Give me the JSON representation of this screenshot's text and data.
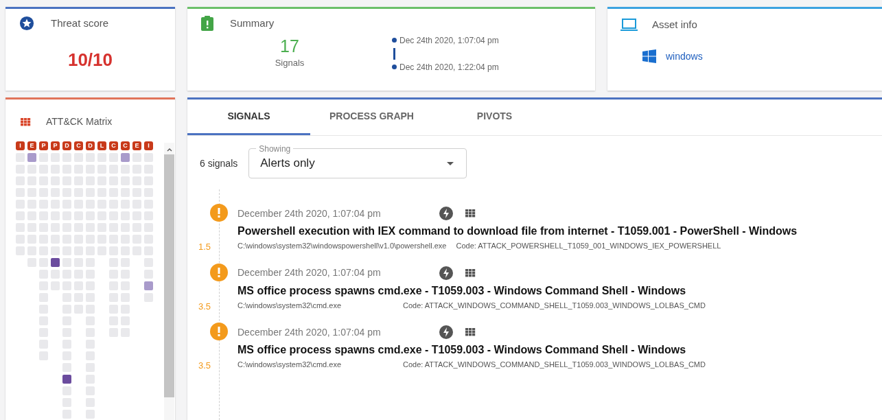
{
  "threat_score": {
    "title": "Threat score",
    "value": "10/10"
  },
  "summary": {
    "title": "Summary",
    "count": "17",
    "count_label": "Signals",
    "start": "Dec 24th 2020, 1:07:04 pm",
    "end": "Dec 24th 2020, 1:22:04 pm"
  },
  "asset_info": {
    "title": "Asset info",
    "os": "windows"
  },
  "matrix": {
    "title": "ATT&CK Matrix",
    "columns": [
      {
        "letter": "I",
        "cells": [
          {
            "kind": "empty"
          },
          {
            "kind": "empty"
          },
          {
            "kind": "empty"
          },
          {
            "kind": "empty"
          },
          {
            "kind": "empty"
          },
          {
            "kind": "empty"
          },
          {
            "kind": "empty"
          },
          {
            "kind": "empty"
          },
          {
            "kind": "empty"
          }
        ]
      },
      {
        "letter": "E",
        "cells": [
          {
            "kind": "low"
          },
          {
            "kind": "empty"
          },
          {
            "kind": "empty"
          },
          {
            "kind": "empty"
          },
          {
            "kind": "empty"
          },
          {
            "kind": "empty"
          },
          {
            "kind": "empty"
          },
          {
            "kind": "empty"
          },
          {
            "kind": "empty"
          },
          {
            "kind": "empty"
          }
        ]
      },
      {
        "letter": "P",
        "cells": [
          {
            "kind": "empty"
          },
          {
            "kind": "empty"
          },
          {
            "kind": "empty"
          },
          {
            "kind": "empty"
          },
          {
            "kind": "empty"
          },
          {
            "kind": "empty"
          },
          {
            "kind": "empty"
          },
          {
            "kind": "empty"
          },
          {
            "kind": "empty"
          },
          {
            "kind": "empty"
          },
          {
            "kind": "empty"
          },
          {
            "kind": "empty"
          },
          {
            "kind": "empty"
          },
          {
            "kind": "empty"
          },
          {
            "kind": "empty"
          },
          {
            "kind": "empty"
          },
          {
            "kind": "empty"
          },
          {
            "kind": "empty"
          }
        ]
      },
      {
        "letter": "P",
        "cells": [
          {
            "kind": "empty"
          },
          {
            "kind": "empty"
          },
          {
            "kind": "empty"
          },
          {
            "kind": "empty"
          },
          {
            "kind": "empty"
          },
          {
            "kind": "empty"
          },
          {
            "kind": "empty"
          },
          {
            "kind": "empty"
          },
          {
            "kind": "empty"
          },
          {
            "kind": "high"
          },
          {
            "kind": "empty"
          },
          {
            "kind": "empty"
          }
        ]
      },
      {
        "letter": "D",
        "cells": [
          {
            "kind": "empty"
          },
          {
            "kind": "empty"
          },
          {
            "kind": "empty"
          },
          {
            "kind": "empty"
          },
          {
            "kind": "empty"
          },
          {
            "kind": "empty"
          },
          {
            "kind": "empty"
          },
          {
            "kind": "empty"
          },
          {
            "kind": "empty"
          },
          {
            "kind": "empty"
          },
          {
            "kind": "empty"
          },
          {
            "kind": "empty"
          },
          {
            "kind": "empty"
          },
          {
            "kind": "empty"
          },
          {
            "kind": "empty"
          },
          {
            "kind": "empty"
          },
          {
            "kind": "empty"
          },
          {
            "kind": "empty"
          },
          {
            "kind": "empty"
          },
          {
            "kind": "high"
          },
          {
            "kind": "empty"
          },
          {
            "kind": "empty"
          },
          {
            "kind": "empty"
          }
        ]
      },
      {
        "letter": "C",
        "cells": [
          {
            "kind": "empty"
          },
          {
            "kind": "empty"
          },
          {
            "kind": "empty"
          },
          {
            "kind": "empty"
          },
          {
            "kind": "empty"
          },
          {
            "kind": "empty"
          },
          {
            "kind": "empty"
          },
          {
            "kind": "empty"
          },
          {
            "kind": "empty"
          },
          {
            "kind": "empty"
          },
          {
            "kind": "empty"
          },
          {
            "kind": "empty"
          },
          {
            "kind": "empty"
          },
          {
            "kind": "empty"
          }
        ]
      },
      {
        "letter": "D",
        "cells": [
          {
            "kind": "empty"
          },
          {
            "kind": "empty"
          },
          {
            "kind": "empty"
          },
          {
            "kind": "empty"
          },
          {
            "kind": "empty"
          },
          {
            "kind": "empty"
          },
          {
            "kind": "empty"
          },
          {
            "kind": "empty"
          },
          {
            "kind": "empty"
          },
          {
            "kind": "empty"
          },
          {
            "kind": "empty"
          },
          {
            "kind": "empty"
          },
          {
            "kind": "empty"
          },
          {
            "kind": "empty"
          },
          {
            "kind": "empty"
          },
          {
            "kind": "empty"
          },
          {
            "kind": "empty"
          },
          {
            "kind": "empty"
          },
          {
            "kind": "empty"
          },
          {
            "kind": "empty"
          },
          {
            "kind": "empty"
          },
          {
            "kind": "empty"
          },
          {
            "kind": "empty"
          }
        ]
      },
      {
        "letter": "L",
        "cells": [
          {
            "kind": "empty"
          },
          {
            "kind": "empty"
          },
          {
            "kind": "empty"
          },
          {
            "kind": "empty"
          },
          {
            "kind": "empty"
          },
          {
            "kind": "empty"
          },
          {
            "kind": "empty"
          },
          {
            "kind": "empty"
          },
          {
            "kind": "empty"
          }
        ]
      },
      {
        "letter": "C",
        "cells": [
          {
            "kind": "empty"
          },
          {
            "kind": "empty"
          },
          {
            "kind": "empty"
          },
          {
            "kind": "empty"
          },
          {
            "kind": "empty"
          },
          {
            "kind": "empty"
          },
          {
            "kind": "empty"
          },
          {
            "kind": "empty"
          },
          {
            "kind": "empty"
          },
          {
            "kind": "empty"
          },
          {
            "kind": "empty"
          },
          {
            "kind": "empty"
          },
          {
            "kind": "empty"
          },
          {
            "kind": "empty"
          },
          {
            "kind": "empty"
          },
          {
            "kind": "empty"
          }
        ]
      },
      {
        "letter": "C",
        "cells": [
          {
            "kind": "low"
          },
          {
            "kind": "empty"
          },
          {
            "kind": "empty"
          },
          {
            "kind": "empty"
          },
          {
            "kind": "empty"
          },
          {
            "kind": "empty"
          },
          {
            "kind": "empty"
          },
          {
            "kind": "empty"
          },
          {
            "kind": "empty"
          },
          {
            "kind": "empty"
          },
          {
            "kind": "empty"
          },
          {
            "kind": "empty"
          },
          {
            "kind": "empty"
          },
          {
            "kind": "empty"
          },
          {
            "kind": "empty"
          },
          {
            "kind": "empty"
          }
        ]
      },
      {
        "letter": "E",
        "cells": [
          {
            "kind": "empty"
          },
          {
            "kind": "empty"
          },
          {
            "kind": "empty"
          },
          {
            "kind": "empty"
          },
          {
            "kind": "empty"
          },
          {
            "kind": "empty"
          },
          {
            "kind": "empty"
          },
          {
            "kind": "empty"
          },
          {
            "kind": "empty"
          }
        ]
      },
      {
        "letter": "I",
        "cells": [
          {
            "kind": "empty"
          },
          {
            "kind": "empty"
          },
          {
            "kind": "empty"
          },
          {
            "kind": "empty"
          },
          {
            "kind": "empty"
          },
          {
            "kind": "empty"
          },
          {
            "kind": "empty"
          },
          {
            "kind": "empty"
          },
          {
            "kind": "empty"
          },
          {
            "kind": "empty"
          },
          {
            "kind": "empty"
          },
          {
            "kind": "low"
          },
          {
            "kind": "empty"
          }
        ]
      }
    ]
  },
  "tabs": [
    {
      "label": "SIGNALS",
      "selected": true
    },
    {
      "label": "PROCESS GRAPH",
      "selected": false
    },
    {
      "label": "PIVOTS",
      "selected": false
    }
  ],
  "signal_count": "6 signals",
  "filter": {
    "label": "Showing",
    "value": "Alerts only"
  },
  "signals": [
    {
      "time": "December 24th 2020, 1:07:04 pm",
      "title": "Powershell execution with IEX command to download file from internet - T1059.001 - PowerShell - Windows",
      "score": "1.5",
      "path": "C:\\windows\\system32\\windowspowershell\\v1.0\\powershell.exe",
      "code": "Code: ATTACK_POWERSHELL_T1059_001_WINDOWS_IEX_POWERSHELL"
    },
    {
      "time": "December 24th 2020, 1:07:04 pm",
      "title": "MS office process spawns cmd.exe - T1059.003 - Windows Command Shell - Windows",
      "score": "3.5",
      "path": "C:\\windows\\system32\\cmd.exe",
      "code": "Code: ATTACK_WINDOWS_COMMAND_SHELL_T1059.003_WINDOWS_LOLBAS_CMD"
    },
    {
      "time": "December 24th 2020, 1:07:04 pm",
      "title": "MS office process spawns cmd.exe - T1059.003 - Windows Command Shell - Windows",
      "score": "3.5",
      "path": "C:\\windows\\system32\\cmd.exe",
      "code": "Code: ATTACK_WINDOWS_COMMAND_SHELL_T1059.003_WINDOWS_LOLBAS_CMD"
    }
  ]
}
